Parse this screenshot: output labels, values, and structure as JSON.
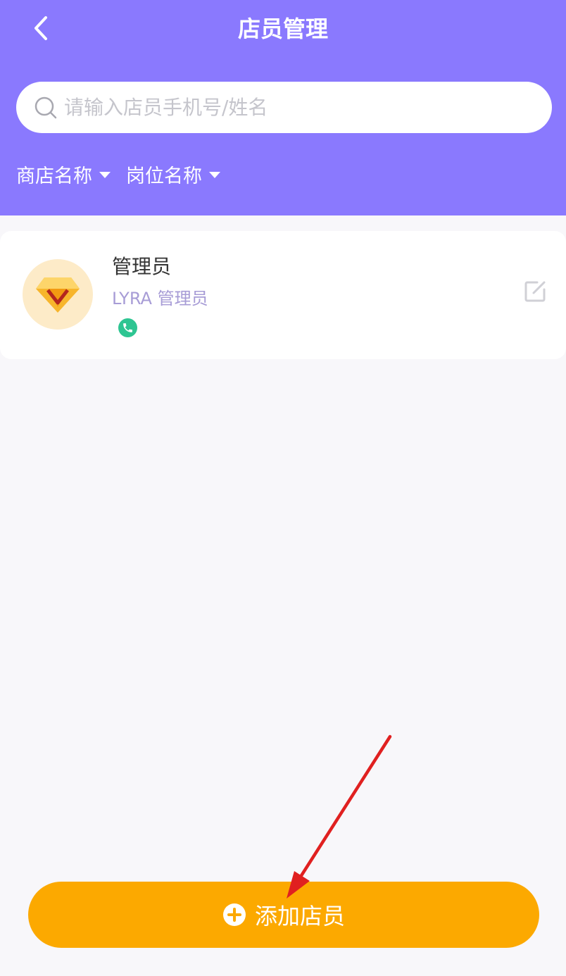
{
  "header": {
    "title": "店员管理",
    "back_icon": "chevron-left-icon"
  },
  "search": {
    "placeholder": "请输入店员手机号/姓名",
    "icon": "search-icon"
  },
  "filters": [
    {
      "label": "商店名称",
      "icon": "caret-down-icon"
    },
    {
      "label": "岗位名称",
      "icon": "caret-down-icon"
    }
  ],
  "members": [
    {
      "name": "管理员",
      "role": "LYRA 管理员",
      "avatar_icon": "diamond-icon",
      "phone_icon": "phone-icon",
      "edit_icon": "edit-icon"
    }
  ],
  "add_button": {
    "label": "添加店员",
    "icon": "plus-circle-icon"
  },
  "colors": {
    "header": "#8a79fe",
    "page_bg": "#f8f7fa",
    "button": "#fca900",
    "role_text": "#a79cd6",
    "phone": "#2ec592",
    "annotation_arrow": "#e02020"
  }
}
